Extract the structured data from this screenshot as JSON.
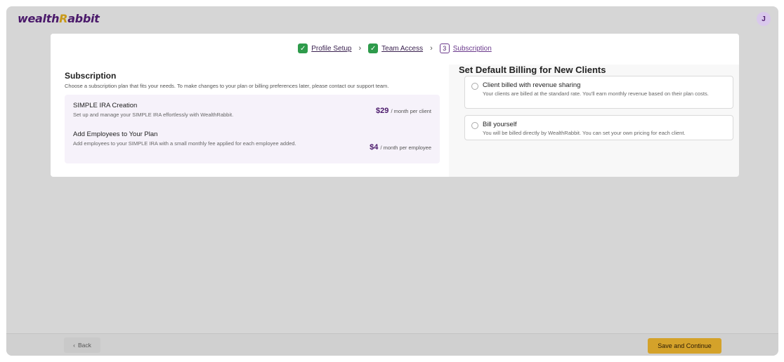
{
  "header": {
    "logo_main": "wealth",
    "logo_r": "R",
    "logo_tail": "abbit",
    "avatar_initial": "J"
  },
  "stepper": {
    "steps": [
      {
        "label": "Profile Setup",
        "state": "completed"
      },
      {
        "label": "Team Access",
        "state": "completed"
      },
      {
        "label": "Subscription",
        "state": "active",
        "number": "3"
      }
    ],
    "check_glyph": "✓",
    "chevron_glyph": "›"
  },
  "subscription": {
    "title": "Subscription",
    "description": "Choose a subscription plan that fits your needs. To make changes to your plan or billing preferences later, please contact our support team.",
    "plans": [
      {
        "name": "SIMPLE IRA Creation",
        "description": "Set up and manage your SIMPLE IRA effortlessly with WealthRabbit.",
        "price": "$29",
        "unit": "/ month per client"
      },
      {
        "name": "Add Employees to Your Plan",
        "description": "Add employees to your SIMPLE IRA with a small monthly fee applied for each employee added.",
        "price": "$4",
        "unit": "/ month per employee"
      }
    ]
  },
  "billing": {
    "title": "Set Default Billing for New Clients",
    "options": [
      {
        "title": "Client billed with revenue sharing",
        "description": "Your clients are billed at the standard rate. You'll earn monthly revenue based on their plan costs.",
        "selected": false
      },
      {
        "title": "Bill yourself",
        "description": "You will be billed directly by WealthRabbit. You can set your own pricing for each client.",
        "selected": false
      }
    ]
  },
  "footer": {
    "back_label": "Back",
    "back_icon": "‹",
    "save_label": "Save and Continue"
  },
  "colors": {
    "brand_purple": "#4b1a6b",
    "brand_gold": "#d4a22a",
    "step_complete": "#2e9b4b"
  }
}
